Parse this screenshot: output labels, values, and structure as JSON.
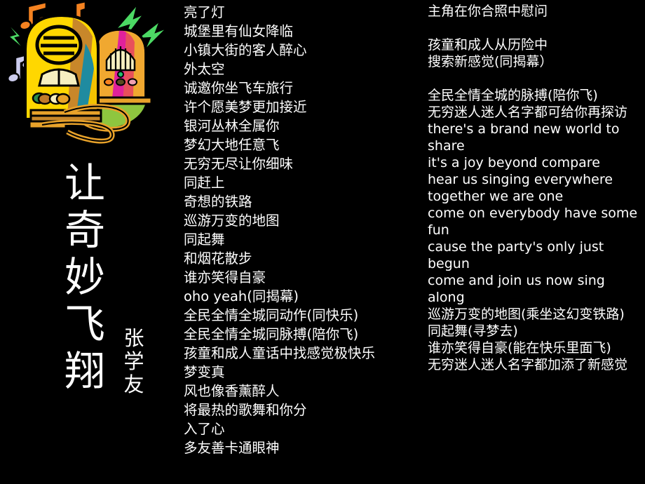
{
  "slide": {
    "background_color": "#000000",
    "text_color": "#ffffff",
    "title_vertical": "让奇妙飞翔",
    "title_chars": [
      "让",
      "奇",
      "妙",
      "飞",
      "翔"
    ],
    "artist_vertical": "张学友",
    "artist_chars": [
      "张",
      "学",
      "友"
    ]
  },
  "clipart": {
    "name": "two-vintage-radios-with-music-notes-and-lightning-bolts",
    "colors": {
      "radio_left_body": "#ffd700",
      "radio_left_shade": "#c8872a",
      "radio_right_body": "#f0a830",
      "radio_right_magenta": "#e0219b",
      "radio_right_red": "#e8505b",
      "teal_panel": "#1f8ba0",
      "ground_green": "#8ec63f",
      "note_orange": "#f58220",
      "note_lavender": "#c8c8e8",
      "bolt_green": "#4cd964",
      "outline": "#000000"
    }
  },
  "lyrics": {
    "column_middle": [
      "亮了灯",
      "城堡里有仙女降临",
      "小镇大街的客人醉心",
      "外太空",
      "诚邀你坐飞车旅行",
      "许个愿美梦更加接近",
      "银河丛林全属你",
      "梦幻大地任意飞",
      "无穷无尽让你细味",
      "同赶上",
      "奇想的铁路",
      "巡游万变的地图",
      "同起舞",
      "和烟花散步",
      "谁亦笑得自豪",
      "oho yeah(同揭幕)",
      "全民全情全城同动作(同快乐)",
      "全民全情全城同脉搏(陪你飞)",
      "孩童和成人童话中找感觉极快乐",
      "梦变真",
      "风也像香薰醉人",
      "将最热的歌舞和你分",
      "入了心",
      "多友善卡通眼神"
    ],
    "column_right": [
      "主角在你合照中慰问",
      "",
      "孩童和成人从历险中",
      "搜索新感觉(同揭幕）",
      "",
      "全民全情全城的脉搏(陪你飞)",
      "无穷迷人迷人名字都可给你再探访",
      "there's a brand new world to share",
      "it's a joy beyond compare",
      "hear us singing everywhere",
      "together we are one",
      "come on everybody have some fun",
      "cause the party's only just begun",
      "come and join us now sing along",
      "巡游万变的地图(乘坐这幻变铁路)",
      "同起舞(寻梦去)",
      "谁亦笑得自豪(能在快乐里面飞)",
      "无穷迷人迷人名字都加添了新感觉"
    ]
  }
}
